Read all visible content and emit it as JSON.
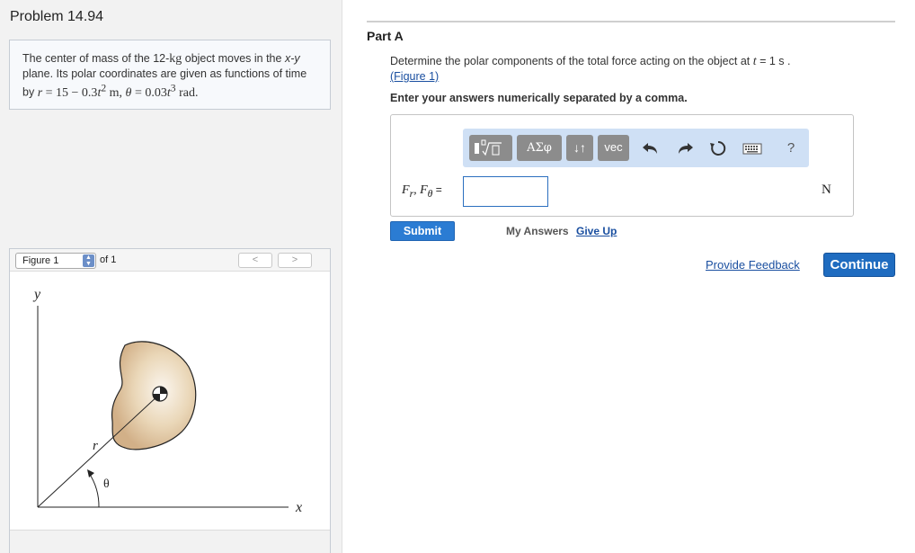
{
  "problem": {
    "title": "Problem 14.94",
    "text_prefix": "The center of mass of the 12-",
    "mass_unit": "kg",
    "text_mid": " object moves in the ",
    "plane_xy": "x-y",
    "text_line2": " plane. Its polar coordinates are given as functions of time by ",
    "r_symbol": "r",
    "r_expr": " = 15  −  0.3",
    "t_symbol": "t",
    "r_exp": "2",
    "r_unit": " m, ",
    "theta_symbol": "θ",
    "theta_expr": " = 0.03",
    "theta_exp": "3",
    "theta_unit": " rad."
  },
  "figure": {
    "selected": "Figure 1",
    "of_label": "of 1",
    "prev_label": "<",
    "next_label": ">",
    "labels": {
      "y": "y",
      "x": "x",
      "r": "r",
      "theta": "θ"
    }
  },
  "part": {
    "title": "Part A",
    "question_prefix": "Determine the polar components of the total force acting on the object at ",
    "question_t": "t",
    "question_suffix": " = 1 s .",
    "figure_link": "(Figure 1)",
    "instruction": "Enter your answers numerically separated by a comma."
  },
  "toolbar": {
    "greek": "ΑΣφ",
    "arrows": "↓↑",
    "vec": "vec",
    "help": "?"
  },
  "answer": {
    "label": "F",
    "label_sub_r": "r",
    "label_sep": ", F",
    "label_sub_theta": "θ",
    "label_eq": " =",
    "value": "",
    "unit": "N"
  },
  "actions": {
    "submit": "Submit",
    "my_answers": "My Answers",
    "give_up": "Give Up",
    "provide_feedback": "Provide Feedback",
    "continue": "Continue"
  }
}
